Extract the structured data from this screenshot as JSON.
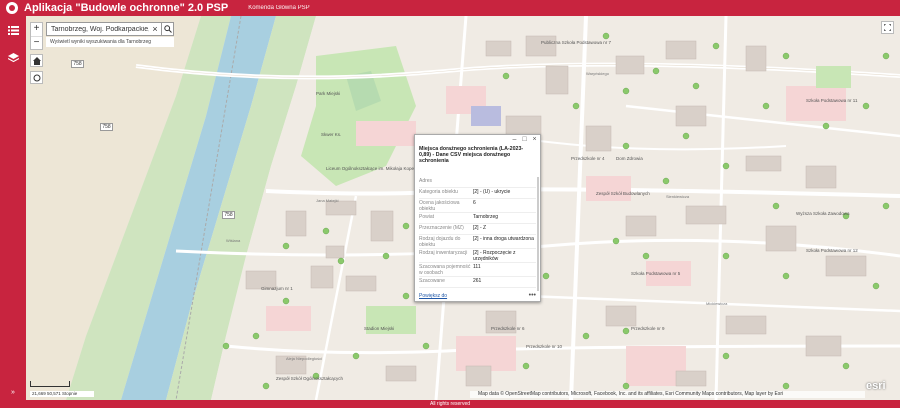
{
  "header": {
    "title": "Aplikacja \"Budowle ochronne\" 2.0 PSP",
    "subtitle": "Komenda Główna PSP"
  },
  "sidebar": {
    "icons": [
      "list-icon",
      "layers-icon"
    ],
    "collapse": "»"
  },
  "search": {
    "value": "Tarnobrzeg, Woj. Podkarpackie, POL",
    "hint": "Wyświetl wyniki wyszukiwania dla Tarnobrzeg"
  },
  "zoom": {
    "in": "+",
    "out": "−"
  },
  "popup": {
    "title": "Miejsca doraźnego schronienia (LA-2023-0,89) - Dane CSV miejsca doraźnego schronienia",
    "rows": [
      {
        "k": "Adres",
        "v": ""
      },
      {
        "k": "Kategoria obiektu",
        "v": "[2] - (U) - ukrycie"
      },
      {
        "k": "Ocena jakościowa obiektu",
        "v": "6"
      },
      {
        "k": "Powiat",
        "v": "Tarnobrzeg"
      },
      {
        "k": "Przeznaczenie (MZ)",
        "v": "[2] - Z"
      },
      {
        "k": "Rodzaj dojazdu do obiektu",
        "v": "[2] - inna droga utwardzona"
      },
      {
        "k": "Rodzaj inwentaryzacji",
        "v": "[2] - Rozpoczęcie z urzędników"
      },
      {
        "k": "Szacowana pojemność w osobach",
        "v": "111"
      },
      {
        "k": "Szacowane",
        "v": "261"
      }
    ],
    "zoom_link": "Powiększ do",
    "more": "•••"
  },
  "map": {
    "coords": "21,669 50,571 Stopnie",
    "attribution": "Map data © OpenStreetMap contributors, Microsoft, Facebook, Inc. and its affiliates, Esri Community Maps contributors, Map layer by Esri",
    "esri": "esri",
    "shields": [
      "758",
      "758",
      "758"
    ],
    "labels": [
      "Skwer Ks.",
      "Liceum Ogólnokształcące im. Mikołaja Kopernika",
      "Przedszkole nr 4",
      "Publiczna Szkoła Podstawowa nr 7",
      "Szkoła Podstawowa nr 11",
      "Przedszkole nr 9",
      "Dom Zdrowia",
      "Zespół Szkół Budowlanych",
      "Przedszkole nr 6",
      "Wyższa Szkoła Zawodowa",
      "Jana Matejki",
      "Sienkiewicza",
      "Mickiewicza",
      "Waryńskiego",
      "Stadion Miejski",
      "Szkoła Podstawowa nr 5",
      "Szkoła Podstawowa nr 12",
      "Park Miejski",
      "Gimnazjum nr 1",
      "Przedszkole nr 10",
      "Aleja Niepodległości",
      "Wiślana",
      "Kościuszki",
      "Zespół Szkół Ogólnokształcących"
    ]
  },
  "footer": {
    "text": "All rights reserved"
  },
  "colors": {
    "brand": "#c8243f",
    "water": "#a8cfe0",
    "park": "#c8e6b5",
    "road": "#ffffff",
    "building": "#d9d0c9"
  }
}
